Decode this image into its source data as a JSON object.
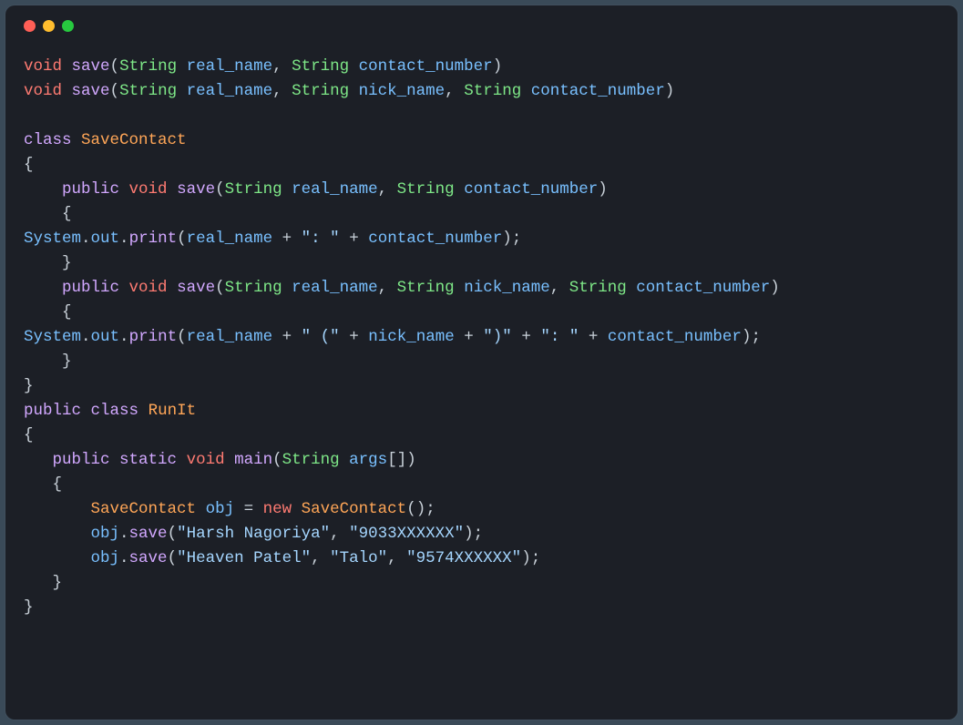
{
  "window": {
    "traffic_lights": [
      "close",
      "minimize",
      "zoom"
    ]
  },
  "tokens": {
    "void": "void",
    "public": "public",
    "static": "static",
    "class": "class",
    "new": "new",
    "String": "String",
    "save": "save",
    "main": "main",
    "print": "print",
    "SaveContact": "SaveContact",
    "RunIt": "RunIt",
    "System": "System",
    "out": "out",
    "obj": "obj",
    "args": "args",
    "real_name": "real_name",
    "nick_name": "nick_name",
    "contact_number": "contact_number",
    "s_colon_sp": "\": \"",
    "s_open_paren": "\" (\"",
    "s_close_paren": "\")\"",
    "s_harsh": "\"Harsh Nagoriya\"",
    "s_9033": "\"9033XXXXXX\"",
    "s_heaven": "\"Heaven Patel\"",
    "s_talo": "\"Talo\"",
    "s_9574": "\"9574XXXXXX\""
  }
}
